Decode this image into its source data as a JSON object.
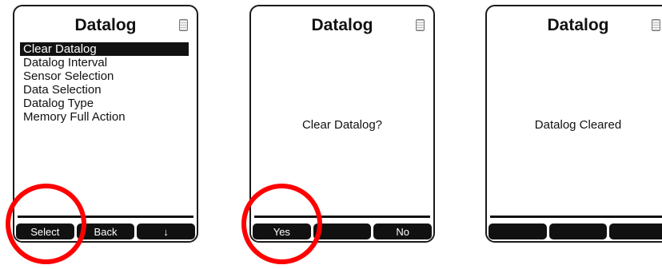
{
  "screens": [
    {
      "title": "Datalog",
      "menu": [
        "Clear Datalog",
        "Datalog Interval",
        "Sensor Selection",
        "Data Selection",
        "Datalog Type",
        "Memory Full Action"
      ],
      "softkeys": [
        "Select",
        "Back",
        "↓"
      ]
    },
    {
      "title": "Datalog",
      "message": "Clear Datalog?",
      "softkeys": [
        "Yes",
        "",
        "No"
      ]
    },
    {
      "title": "Datalog",
      "message": "Datalog Cleared",
      "softkeys": [
        "",
        "",
        ""
      ]
    }
  ],
  "icons": {
    "memory": "memory-card-icon"
  },
  "colors": {
    "highlight_circle": "#ff0000",
    "display_fg": "#111111",
    "display_bg": "#ffffff"
  }
}
